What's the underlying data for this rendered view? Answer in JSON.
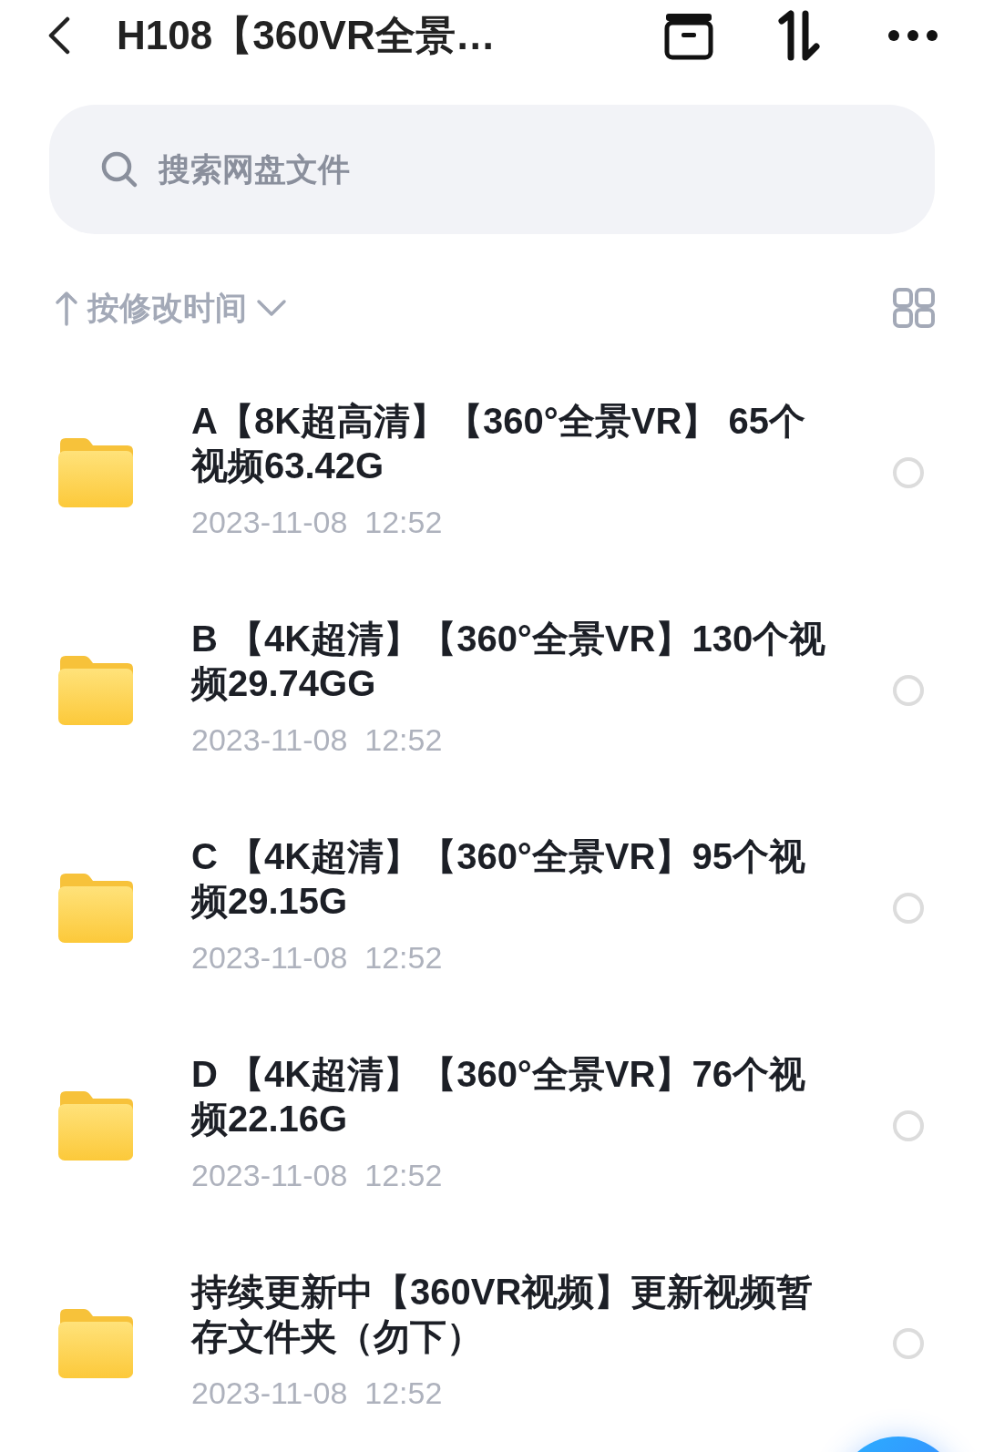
{
  "header": {
    "title": "H108【360VR全景…"
  },
  "search": {
    "placeholder": "搜索网盘文件"
  },
  "sort": {
    "label": "按修改时间"
  },
  "files": [
    {
      "name": "A【8K超高清】【360°全景VR】 65个视频63.42G",
      "date": "2023-11-08  12:52",
      "selected": false
    },
    {
      "name": "B 【4K超清】【360°全景VR】130个视频29.74GG",
      "date": "2023-11-08  12:52",
      "selected": false
    },
    {
      "name": "C 【4K超清】【360°全景VR】95个视频29.15G",
      "date": "2023-11-08  12:52",
      "selected": false
    },
    {
      "name": "D 【4K超清】【360°全景VR】76个视频22.16G",
      "date": "2023-11-08  12:52",
      "selected": false
    },
    {
      "name": "持续更新中【360VR视频】更新视频暂存文件夹（勿下）",
      "date": "2023-11-08  12:52",
      "selected": false
    }
  ]
}
